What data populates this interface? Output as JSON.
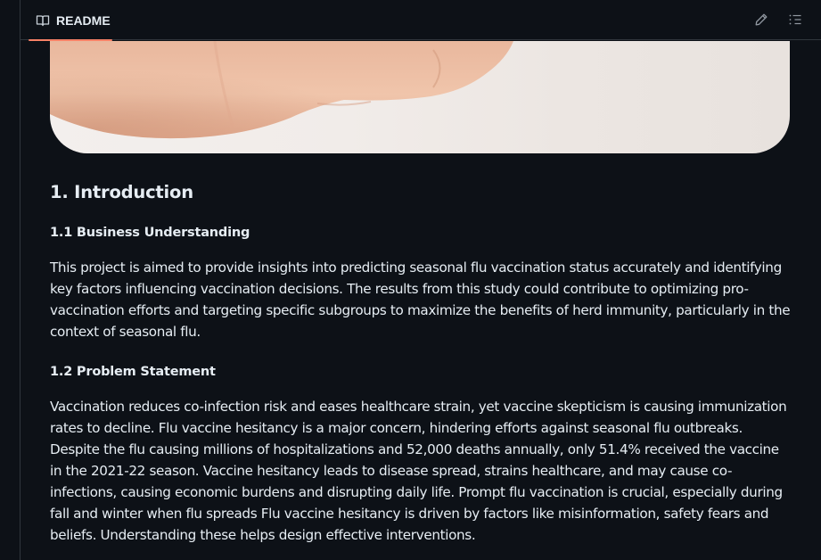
{
  "header": {
    "tab_label": "README"
  },
  "icons": {
    "tab": "book-icon",
    "edit": "pencil-icon",
    "outline": "list-icon"
  },
  "colors": {
    "background": "#0d1117",
    "border": "#30363d",
    "tab_underline": "#f78166",
    "text": "#e6edf3"
  },
  "article": {
    "heading": "1. Introduction",
    "section1": {
      "title": "1.1 Business Understanding",
      "body": "This project is aimed to provide insights into predicting seasonal flu vaccination status accurately and identifying key factors influencing vaccination decisions. The results from this study could contribute to optimizing pro-vaccination efforts and targeting specific subgroups to maximize the benefits of herd immunity, particularly in the context of seasonal flu."
    },
    "section2": {
      "title": "1.2 Problem Statement",
      "body": "Vaccination reduces co-infection risk and eases healthcare strain, yet vaccine skepticism is causing immunization rates to decline. Flu vaccine hesitancy is a major concern, hindering efforts against seasonal flu outbreaks. Despite the flu causing millions of hospitalizations and 52,000 deaths annually, only 51.4% received the vaccine in the 2021-22 season. Vaccine hesitancy leads to disease spread, strains healthcare, and may cause co-infections, causing economic burdens and disrupting daily life. Prompt flu vaccination is crucial, especially during fall and winter when flu spreads Flu vaccine hesitancy is driven by factors like misinformation, safety fears and beliefs. Understanding these helps design effective interventions."
    }
  }
}
